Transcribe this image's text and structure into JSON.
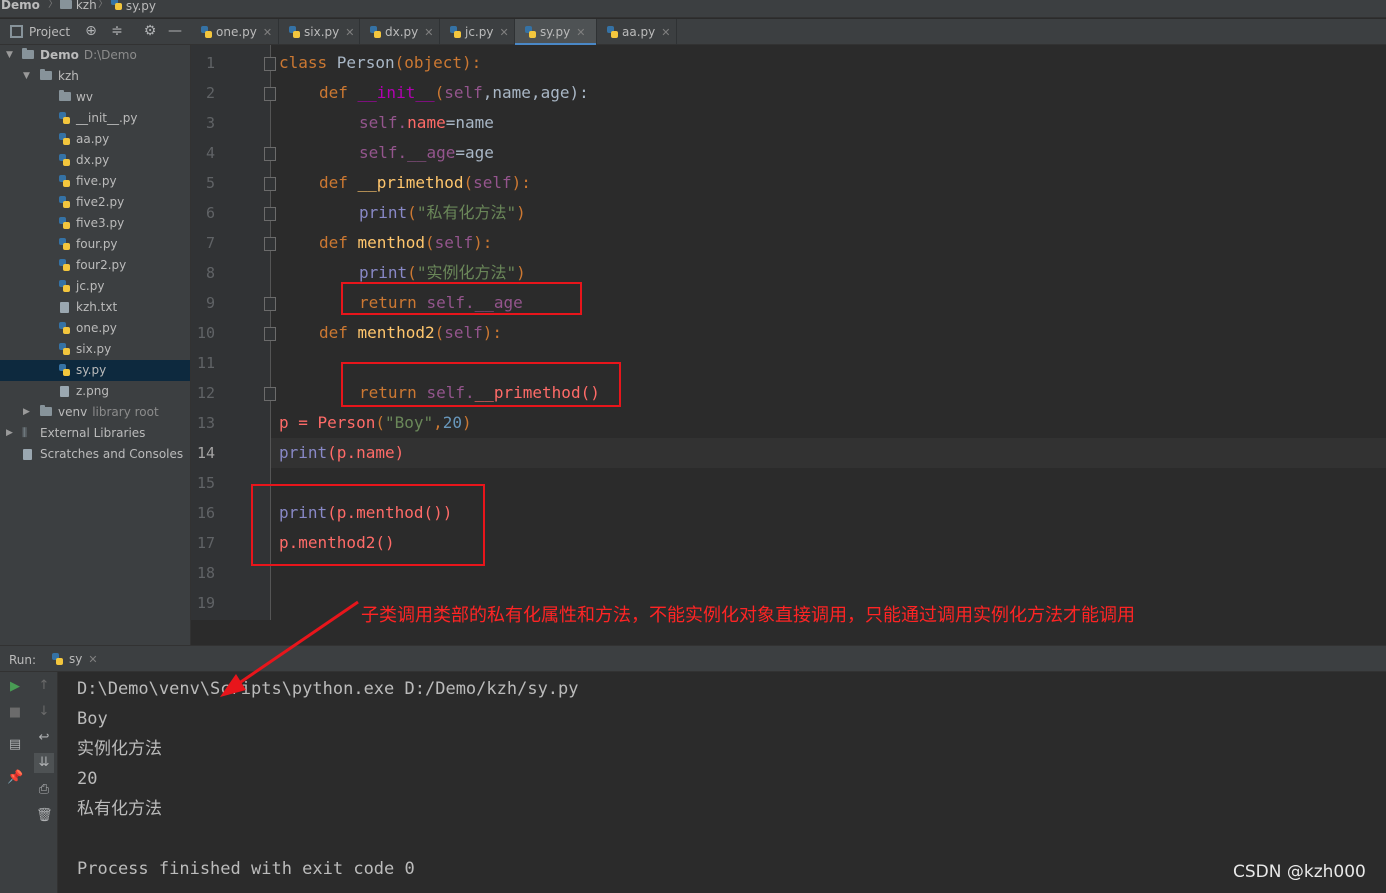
{
  "breadcrumb": [
    "Demo",
    "kzh",
    "sy.py"
  ],
  "project_panel": {
    "title": "Project"
  },
  "tabs": [
    {
      "label": "one.py"
    },
    {
      "label": "six.py"
    },
    {
      "label": "dx.py"
    },
    {
      "label": "jc.py"
    },
    {
      "label": "sy.py"
    },
    {
      "label": "aa.py"
    }
  ],
  "tree": {
    "root_label": "Demo",
    "root_path": "D:\\Demo",
    "kzh": "kzh",
    "items": [
      "wv",
      "__init__.py",
      "aa.py",
      "dx.py",
      "five.py",
      "five2.py",
      "five3.py",
      "four.py",
      "four2.py",
      "jc.py",
      "kzh.txt",
      "one.py",
      "six.py",
      "sy.py",
      "z.png"
    ],
    "venv": "venv",
    "venv_hint": "library root",
    "external": "External Libraries",
    "scratches": "Scratches and Consoles"
  },
  "line_numbers": [
    "1",
    "2",
    "3",
    "4",
    "5",
    "6",
    "7",
    "8",
    "9",
    "10",
    "11",
    "12",
    "13",
    "14",
    "15",
    "16",
    "17",
    "18",
    "19"
  ],
  "code": {
    "l1": [
      "class ",
      "Person",
      "(object):"
    ],
    "l2": [
      "def ",
      "__init__",
      "(",
      "self",
      ",name,age):"
    ],
    "l3": [
      "self",
      ".",
      "name",
      "=name"
    ],
    "l4": [
      "self",
      ".",
      "__age",
      "=age"
    ],
    "l5": [
      "def ",
      "__primethod",
      "(",
      "self",
      "):"
    ],
    "l6": [
      "print",
      "(",
      "\"私有化方法\"",
      ")"
    ],
    "l7": [
      "def ",
      "menthod",
      "(",
      "self",
      "):"
    ],
    "l8": [
      "print",
      "(",
      "\"实例化方法\"",
      ")"
    ],
    "l9": [
      "return ",
      "self",
      ".",
      "__age"
    ],
    "l10": [
      "def ",
      "menthod2",
      "(",
      "self",
      "):"
    ],
    "l12": [
      "return ",
      "self",
      ".",
      "__primethod()"
    ],
    "l13": [
      "p = ",
      "Person",
      "(",
      "\"Boy\"",
      ",",
      "20",
      ")"
    ],
    "l14": [
      "print",
      "(p.",
      "name",
      ")"
    ],
    "l16": [
      "print",
      "(p.",
      "menthod",
      "())"
    ],
    "l17": [
      "p.",
      "menthod2",
      "()"
    ]
  },
  "annotation": "子类调用类部的私有化属性和方法，不能实例化对象直接调用，只能通过调用实例化方法才能调用",
  "run": {
    "label": "Run:",
    "tab": "sy",
    "output": [
      "D:\\Demo\\venv\\Scripts\\python.exe D:/Demo/kzh/sy.py",
      "Boy",
      "实例化方法",
      "20",
      "私有化方法",
      "",
      "Process finished with exit code 0"
    ]
  },
  "watermark": "CSDN @kzh000",
  "colors": {
    "keyword": "#cc7832",
    "function": "#ffc66d",
    "self": "#94558d",
    "string": "#6a8759",
    "number": "#6897bb",
    "annotation_red": "#e8151b",
    "selection": "#0d293e"
  }
}
